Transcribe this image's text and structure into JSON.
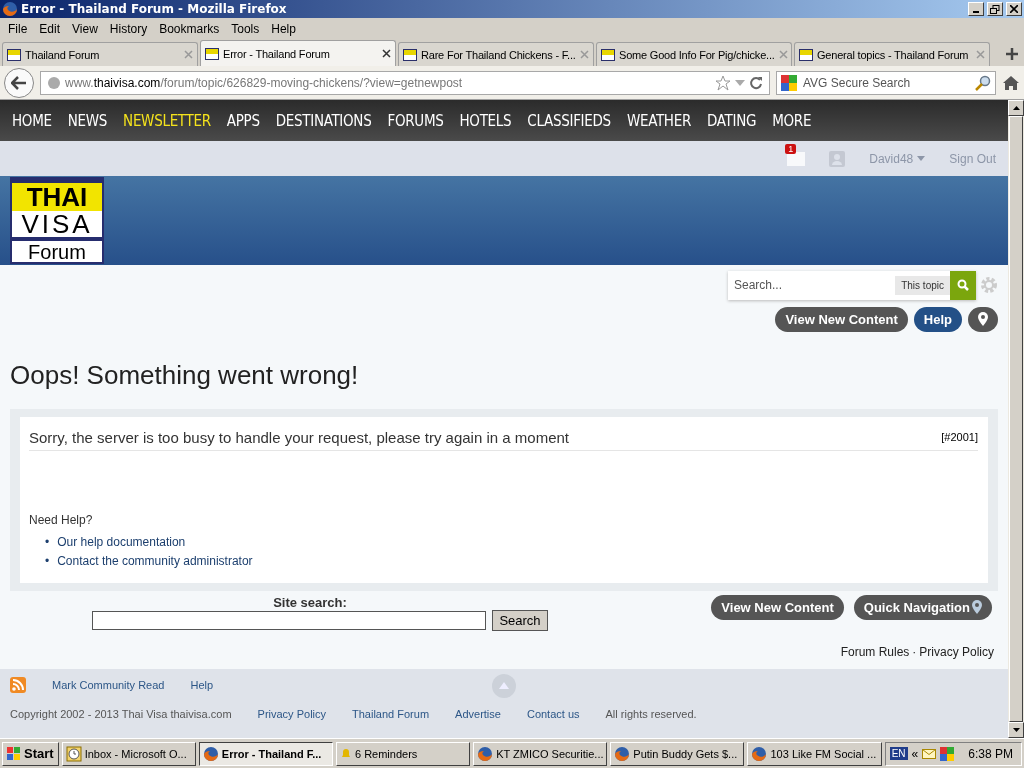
{
  "window": {
    "title": "Error - Thailand Forum - Mozilla Firefox"
  },
  "menu": [
    "File",
    "Edit",
    "View",
    "History",
    "Bookmarks",
    "Tools",
    "Help"
  ],
  "tabs": [
    {
      "label": "Thailand Forum",
      "selected": false
    },
    {
      "label": "Error - Thailand Forum",
      "selected": true
    },
    {
      "label": "Rare For Thailand Chickens - F...",
      "selected": false
    },
    {
      "label": "Some Good Info For Pig/chicke...",
      "selected": false
    },
    {
      "label": "General topics - Thailand Forum",
      "selected": false
    }
  ],
  "address": {
    "prefix": "www.",
    "domain": "thaivisa.com",
    "path": "/forum/topic/626829-moving-chickens/?view=getnewpost"
  },
  "browser_search": {
    "placeholder": "AVG Secure Search"
  },
  "nav": [
    {
      "label": "HOME",
      "highlighted": false
    },
    {
      "label": "NEWS",
      "highlighted": false
    },
    {
      "label": "NEWSLETTER",
      "highlighted": true
    },
    {
      "label": "APPS",
      "highlighted": false
    },
    {
      "label": "DESTINATIONS",
      "highlighted": false
    },
    {
      "label": "FORUMS",
      "highlighted": false
    },
    {
      "label": "HOTELS",
      "highlighted": false
    },
    {
      "label": "CLASSIFIEDS",
      "highlighted": false
    },
    {
      "label": "WEATHER",
      "highlighted": false
    },
    {
      "label": "DATING",
      "highlighted": false
    },
    {
      "label": "MORE",
      "highlighted": false
    }
  ],
  "user_bar": {
    "notification_count": "1",
    "username": "David48",
    "sign_out": "Sign Out"
  },
  "logo": {
    "line_1": "THAI",
    "line_2": "VISA",
    "line_3": "Forum"
  },
  "forum_search": {
    "placeholder": "Search...",
    "scope": "This topic"
  },
  "top_buttons": [
    {
      "label": "View New Content",
      "kind": "dark"
    },
    {
      "label": "Help",
      "kind": "blue"
    },
    {
      "kind": "pin"
    }
  ],
  "heading": "Oops! Something went wrong!",
  "error": {
    "message": "Sorry, the server is too busy to handle your request, please try again in a moment",
    "code": "[#2001]",
    "help_title": "Need Help?",
    "bullet": "•",
    "links": [
      "Our help documentation",
      "Contact the community administrator"
    ]
  },
  "site_search": {
    "label": "Site search:",
    "button": "Search"
  },
  "bottom_buttons": [
    {
      "label": "View New Content",
      "pin": false
    },
    {
      "label": "Quick Navigation",
      "pin": true
    }
  ],
  "legal_links": [
    "Forum Rules",
    "Privacy Policy"
  ],
  "legal_separator": "·",
  "footer": {
    "links": [
      "Mark Community Read",
      "Help"
    ],
    "copyright": "Copyright 2002 - 2013 Thai Visa thaivisa.com",
    "bottom_links": [
      "Privacy Policy",
      "Thailand Forum",
      "Advertise",
      "Contact us"
    ],
    "rights": "All rights reserved."
  },
  "taskbar": {
    "start": "Start",
    "items": [
      {
        "label": "Inbox - Microsoft O...",
        "selected": false,
        "kind": "outlook"
      },
      {
        "label": "Error - Thailand F...",
        "selected": true,
        "kind": "firefox"
      },
      {
        "label": "6 Reminders",
        "selected": false,
        "kind": "bell"
      },
      {
        "label": "KT ZMICO Securitie...",
        "selected": false,
        "kind": "firefox"
      },
      {
        "label": "Putin Buddy Gets $...",
        "selected": false,
        "kind": "firefox"
      },
      {
        "label": "103 Like FM Social ...",
        "selected": false,
        "kind": "firefox"
      }
    ],
    "language": "EN",
    "chevron": "«",
    "time": "6:38 PM"
  }
}
